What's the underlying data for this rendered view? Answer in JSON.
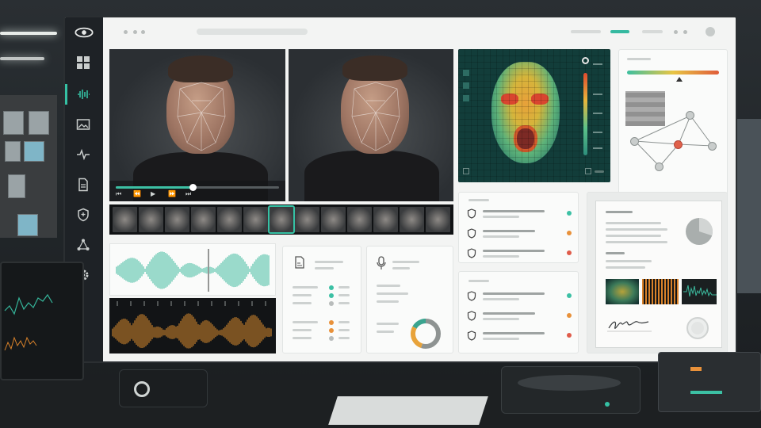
{
  "app": {
    "accent": "#35c1a4",
    "sidebar_icons": [
      "eye-logo-icon",
      "dashboard-grid-icon",
      "waveform-icon",
      "image-icon",
      "pulse-icon",
      "document-icon",
      "shield-icon",
      "network-icon",
      "settings-gear-icon"
    ]
  },
  "video": {
    "progress": 0.47,
    "controls": [
      "skip-back-icon",
      "rewind-icon",
      "play-icon",
      "forward-icon",
      "skip-forward-icon"
    ]
  },
  "filmstrip": {
    "frames": 13,
    "selected_index": 6
  },
  "heatmap": {
    "colors": [
      "#e04a2e",
      "#e8b53b",
      "#5cc289",
      "#2d8e7c"
    ]
  },
  "audio": {
    "wave_color": "#3bb89c",
    "spectrum_color": "#e3912f"
  },
  "status_colors": {
    "ok": "#3cc0a4",
    "warn": "#e8913a",
    "bad": "#e05c4a",
    "neutral": "#b8bcbb"
  },
  "donut": {
    "segments": [
      0.55,
      0.28,
      0.17
    ],
    "colors": [
      "#8e9392",
      "#e8a33a",
      "#3aa48f"
    ]
  },
  "report": {
    "pie_fraction": 0.3
  }
}
